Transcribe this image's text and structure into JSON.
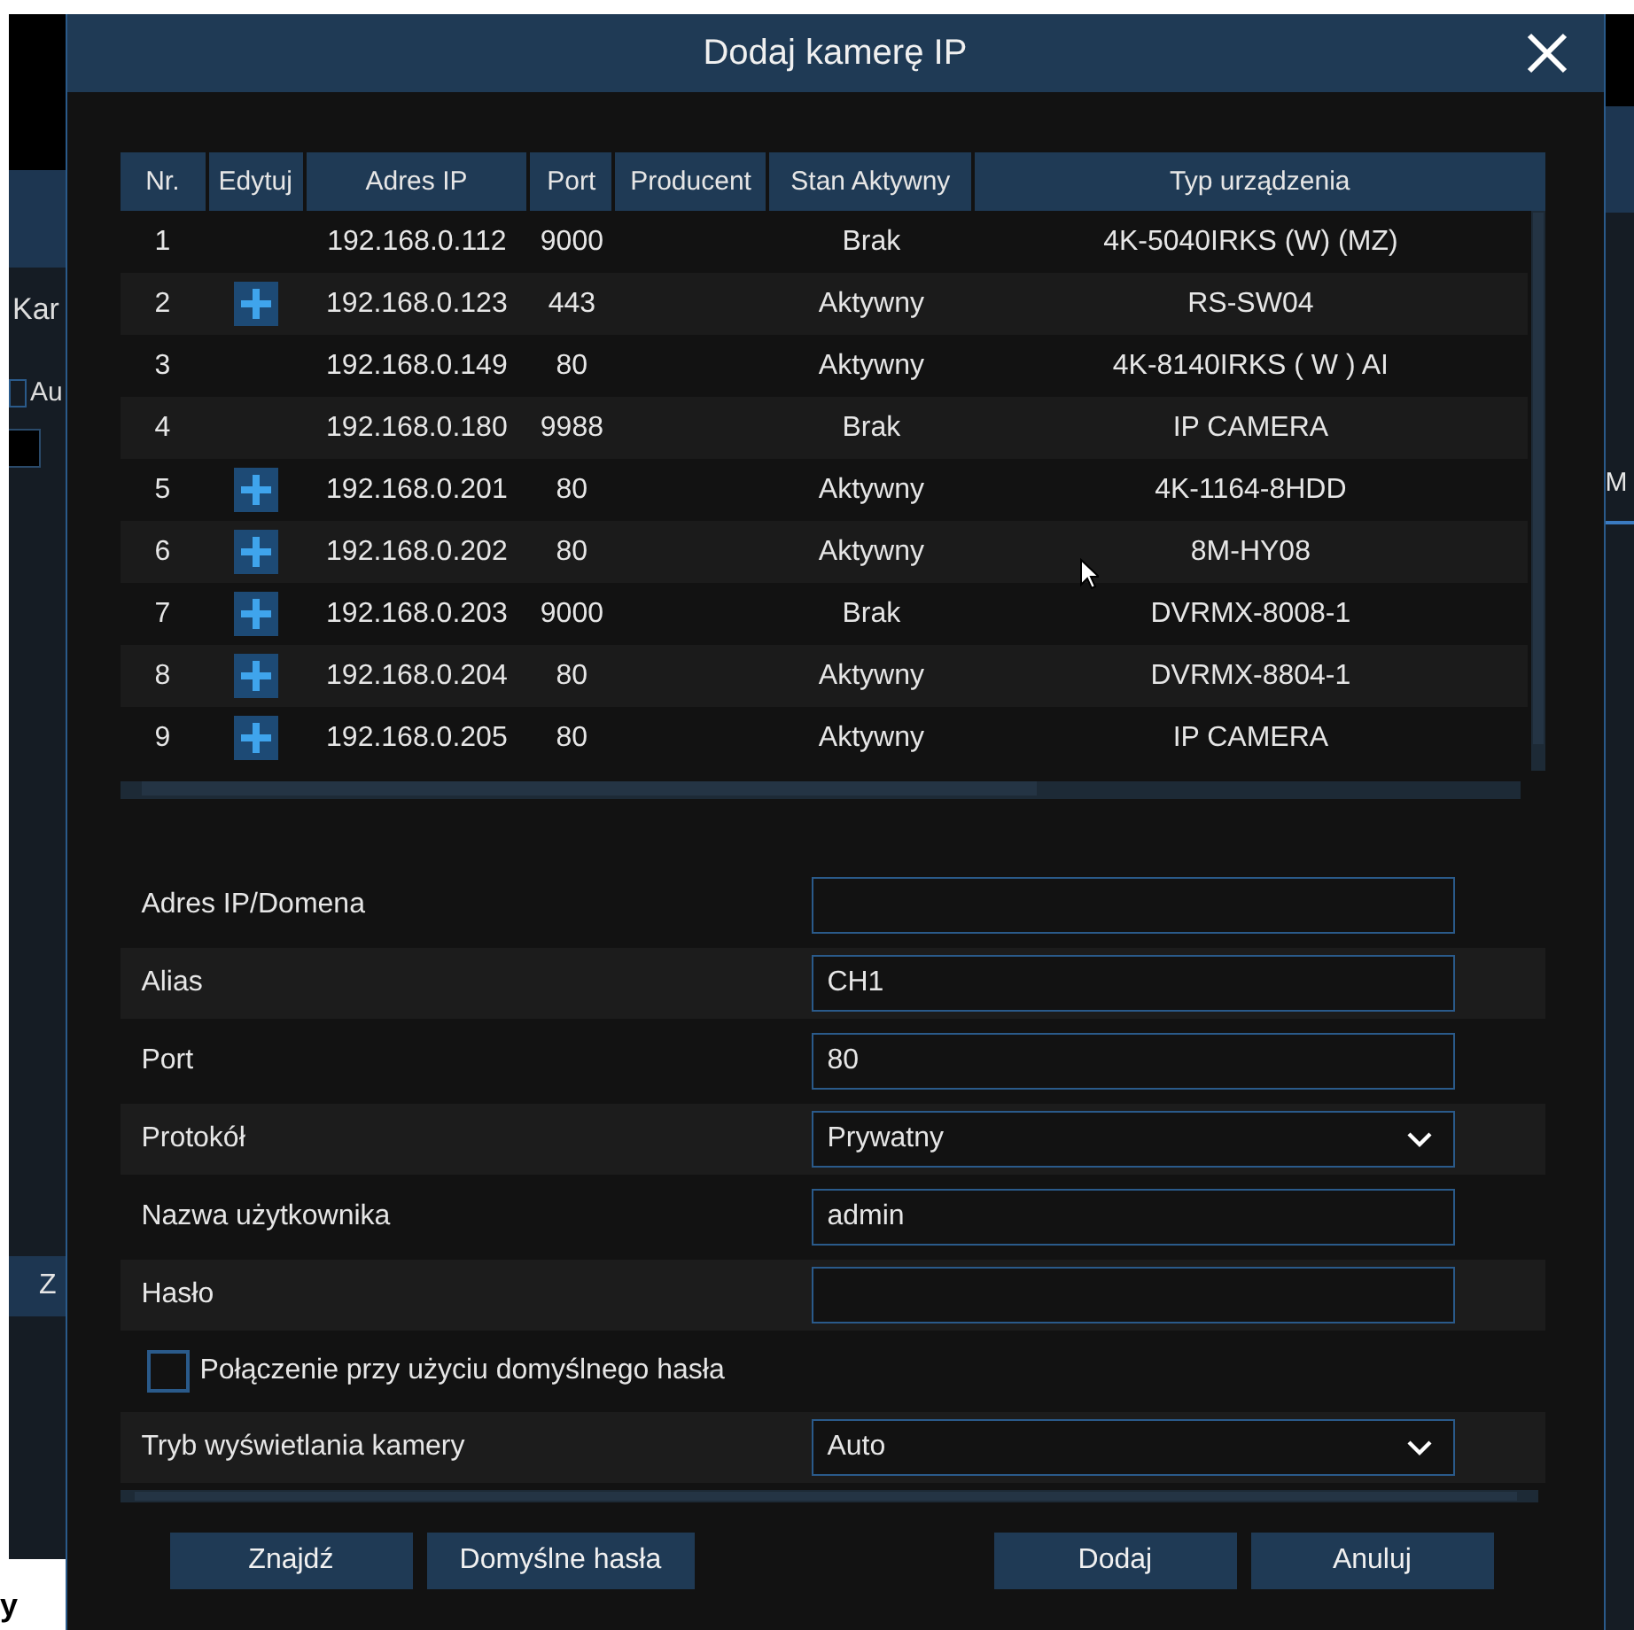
{
  "background": {
    "left_texts": [
      "Kar",
      "Au",
      "Z"
    ],
    "right_texts": [
      "M"
    ],
    "corner_text": "y",
    "checkbox_checked": false
  },
  "dialog": {
    "title": "Dodaj kamerę IP"
  },
  "table": {
    "columns": [
      "Nr.",
      "Edytuj",
      "Adres IP",
      "Port",
      "Producent",
      "Stan Aktywny",
      "Typ urządzenia"
    ],
    "rows": [
      {
        "nr": "1",
        "editable": false,
        "ip": "192.168.0.112",
        "port": "9000",
        "status": "Brak",
        "type": "4K-5040IRKS (W) (MZ)"
      },
      {
        "nr": "2",
        "editable": true,
        "ip": "192.168.0.123",
        "port": "443",
        "status": "Aktywny",
        "type": "RS-SW04"
      },
      {
        "nr": "3",
        "editable": false,
        "ip": "192.168.0.149",
        "port": "80",
        "status": "Aktywny",
        "type": "4K-8140IRKS ( W ) AI"
      },
      {
        "nr": "4",
        "editable": false,
        "ip": "192.168.0.180",
        "port": "9988",
        "status": "Brak",
        "type": "IP CAMERA"
      },
      {
        "nr": "5",
        "editable": true,
        "ip": "192.168.0.201",
        "port": "80",
        "status": "Aktywny",
        "type": "4K-1164-8HDD"
      },
      {
        "nr": "6",
        "editable": true,
        "ip": "192.168.0.202",
        "port": "80",
        "status": "Aktywny",
        "type": "8M-HY08"
      },
      {
        "nr": "7",
        "editable": true,
        "ip": "192.168.0.203",
        "port": "9000",
        "status": "Brak",
        "type": "DVRMX-8008-1"
      },
      {
        "nr": "8",
        "editable": true,
        "ip": "192.168.0.204",
        "port": "80",
        "status": "Aktywny",
        "type": "DVRMX-8804-1"
      },
      {
        "nr": "9",
        "editable": true,
        "ip": "192.168.0.205",
        "port": "80",
        "status": "Aktywny",
        "type": "IP CAMERA"
      }
    ]
  },
  "form": [
    {
      "kind": "text",
      "label": "Adres IP/Domena"
    },
    {
      "kind": "text",
      "label": "Alias",
      "value": "CH1"
    },
    {
      "kind": "text",
      "label": "Port",
      "value": "80"
    },
    {
      "kind": "select",
      "label": "Protokół",
      "value": "Prywatny"
    },
    {
      "kind": "text",
      "label": "Nazwa użytkownika",
      "value": "admin"
    },
    {
      "kind": "text",
      "label": "Hasło"
    },
    {
      "kind": "checkbox",
      "label": "Połączenie przy użyciu domyślnego hasła",
      "checked": false
    },
    {
      "kind": "select",
      "label": "Tryb wyświetlania kamery",
      "value": "Auto"
    }
  ],
  "buttons": [
    "Znajdź",
    "Domyślne hasła",
    "Dodaj",
    "Anuluj"
  ]
}
